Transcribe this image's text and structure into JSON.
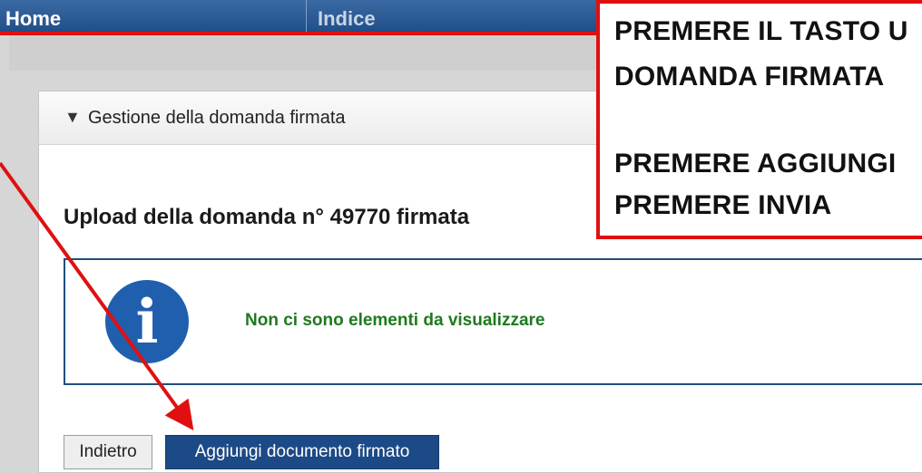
{
  "nav": {
    "home": "Home",
    "index": "Indice"
  },
  "panel": {
    "title": "Gestione della domanda firmata",
    "toggle_icon": "triangle-down-icon"
  },
  "upload": {
    "title": "Upload della domanda n° 49770 firmata"
  },
  "message": {
    "icon": "info-icon",
    "text": "Non ci sono elementi da visualizzare"
  },
  "buttons": {
    "back": "Indietro",
    "add": "Aggiungi documento firmato"
  },
  "callout": {
    "line1": "PREMERE IL TASTO U",
    "line2": "DOMANDA FIRMATA",
    "line3": "PREMERE AGGIUNGI",
    "line4": "PREMERE INVIA"
  },
  "colors": {
    "annotation_red": "#e01010",
    "nav_blue": "#1f4c86",
    "button_blue": "#1c4a86",
    "message_green": "#1e7a1e"
  }
}
